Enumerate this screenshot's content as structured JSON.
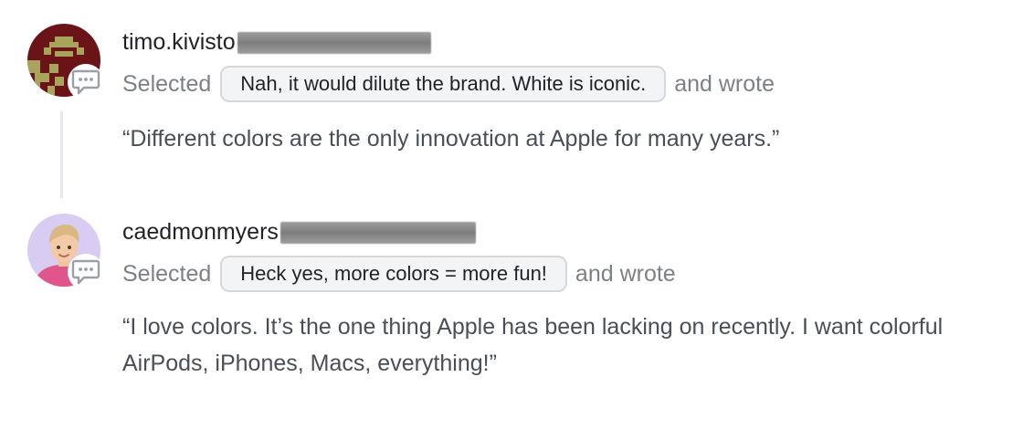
{
  "entries": [
    {
      "username": "timo.kivisto",
      "selected_prefix": "Selected",
      "selected_option": "Nah, it would dilute the brand. White is iconic.",
      "suffix": "and wrote",
      "comment": "“Different colors are the only innovation at Apple for many years.”",
      "avatar_icon": "pixel-art-avatar",
      "badge_icon": "comment-icon"
    },
    {
      "username": "caedmonmyers",
      "selected_prefix": "Selected",
      "selected_option": "Heck yes, more colors = more fun!",
      "suffix": "and wrote",
      "comment": "“I love colors. It’s the one thing Apple has been lacking on recently. I want colorful AirPods, iPhones, Macs, everything!”",
      "avatar_icon": "memoji-avatar",
      "badge_icon": "comment-icon"
    }
  ],
  "colors": {
    "text": "#1f2328",
    "muted": "#7c8088",
    "pill_bg": "#f3f4f6",
    "pill_border": "#d6d8dc",
    "thread_line": "#e6e7ea"
  }
}
